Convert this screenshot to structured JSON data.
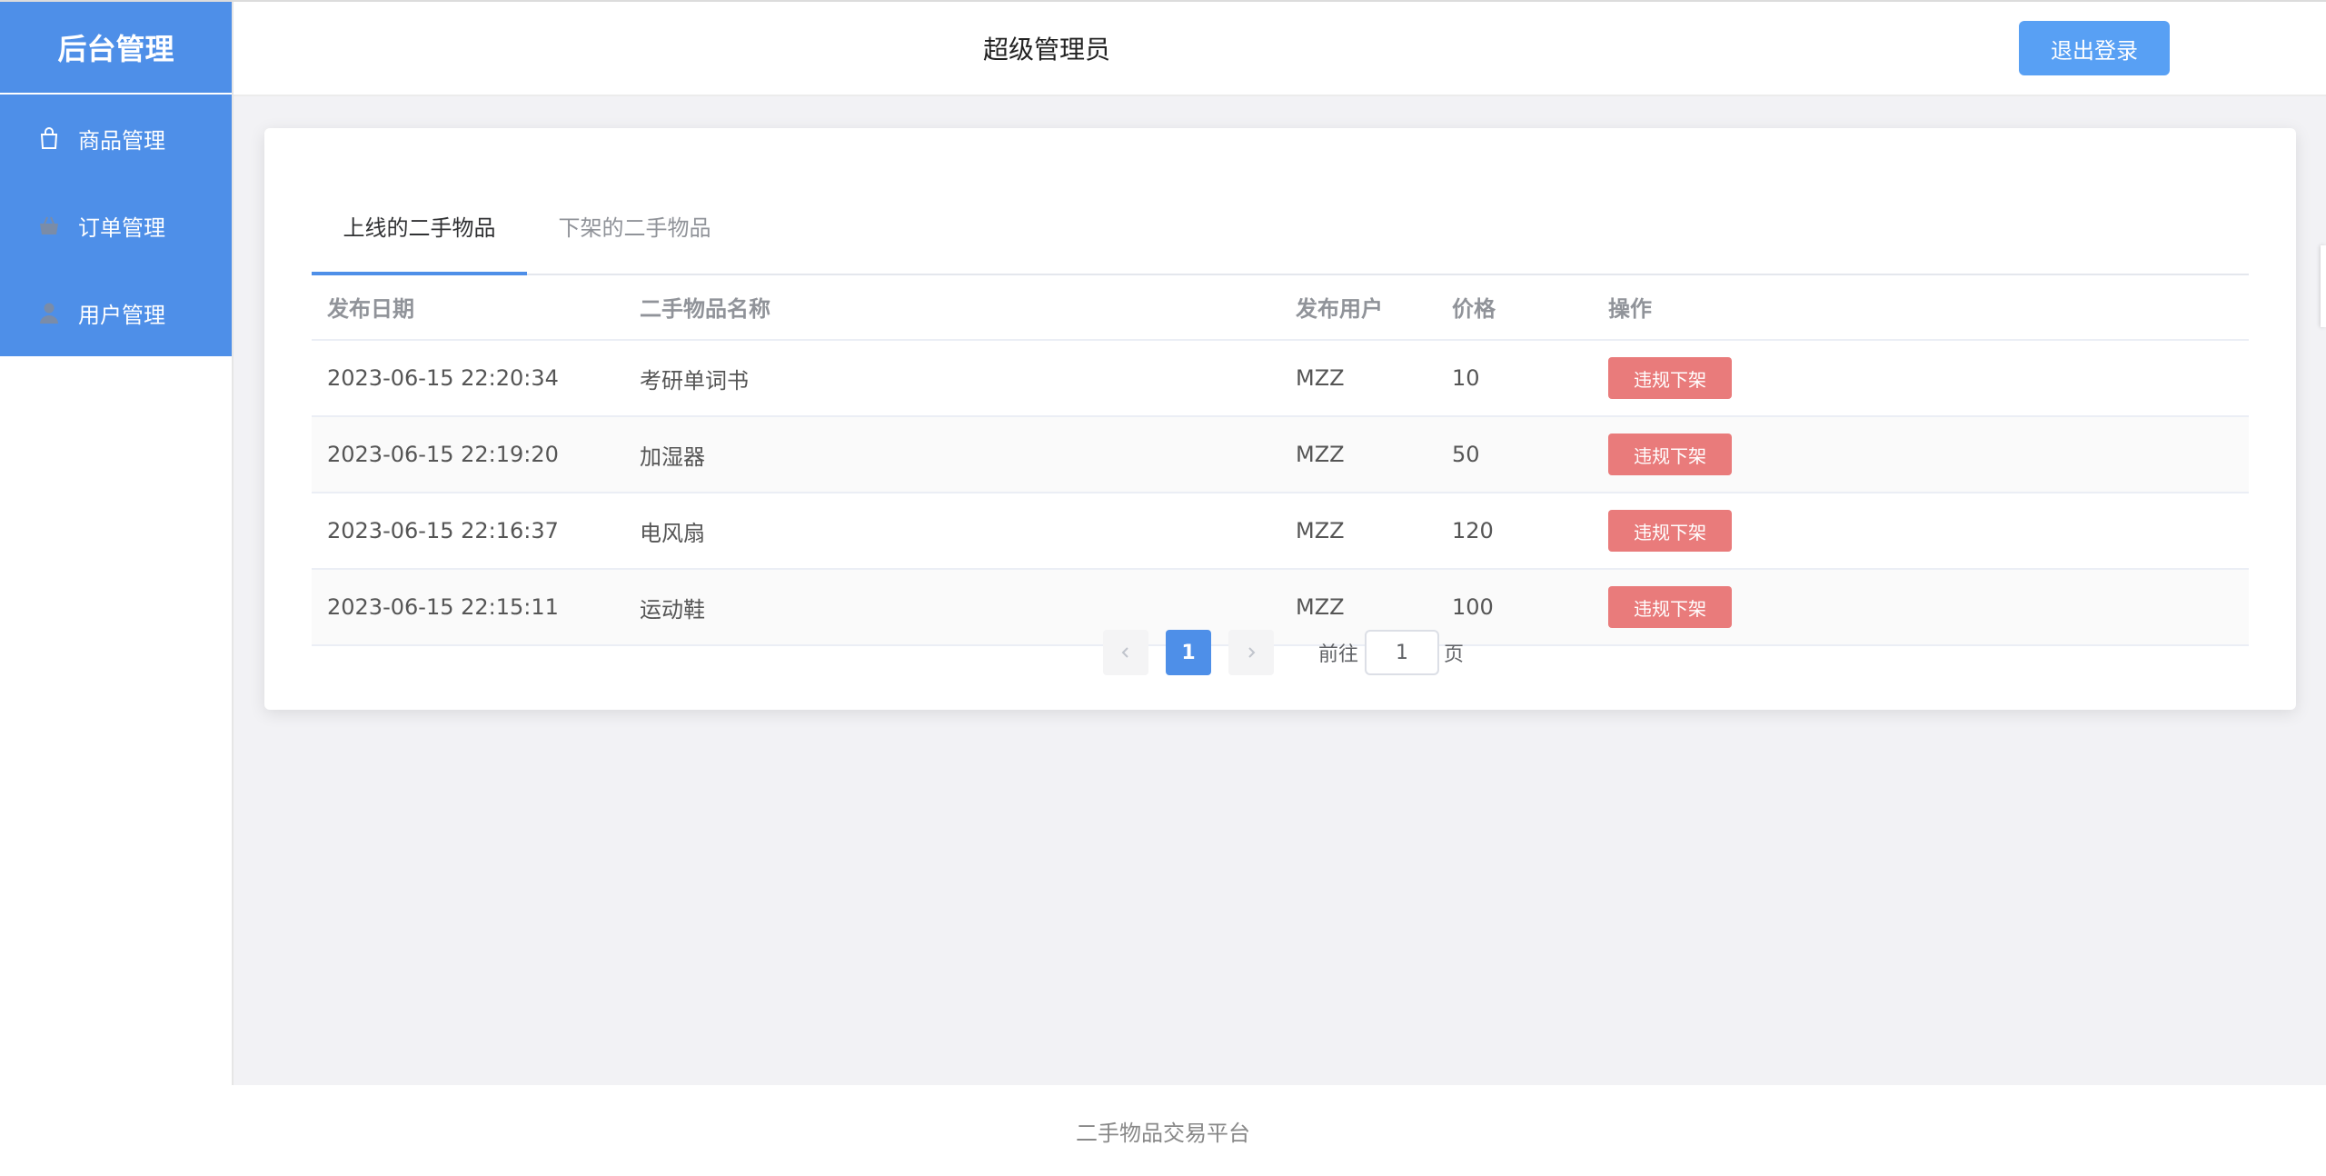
{
  "sidebar": {
    "brand": "后台管理",
    "items": [
      {
        "label": "商品管理",
        "icon": "shopping-bag-icon"
      },
      {
        "label": "订单管理",
        "icon": "basket-icon"
      },
      {
        "label": "用户管理",
        "icon": "user-icon"
      }
    ]
  },
  "header": {
    "title": "超级管理员",
    "logout_label": "退出登录"
  },
  "tabs": [
    {
      "label": "上线的二手物品",
      "active": true
    },
    {
      "label": "下架的二手物品",
      "active": false
    }
  ],
  "table": {
    "columns": [
      "发布日期",
      "二手物品名称",
      "发布用户",
      "价格",
      "操作"
    ],
    "rows": [
      {
        "date": "2023-06-15 22:20:34",
        "name": "考研单词书",
        "user": "MZZ",
        "price": "10",
        "action": "违规下架"
      },
      {
        "date": "2023-06-15 22:19:20",
        "name": "加湿器",
        "user": "MZZ",
        "price": "50",
        "action": "违规下架"
      },
      {
        "date": "2023-06-15 22:16:37",
        "name": "电风扇",
        "user": "MZZ",
        "price": "120",
        "action": "违规下架"
      },
      {
        "date": "2023-06-15 22:15:11",
        "name": "运动鞋",
        "user": "MZZ",
        "price": "100",
        "action": "违规下架"
      }
    ]
  },
  "pagination": {
    "current_page": "1",
    "goto_label": "前往",
    "goto_value": "1",
    "goto_suffix": "页"
  },
  "footer": {
    "text": "二手物品交易平台"
  },
  "colors": {
    "accent": "#4e8fe8",
    "logout_button": "#58a0f4",
    "danger_button": "#e97b7b"
  }
}
